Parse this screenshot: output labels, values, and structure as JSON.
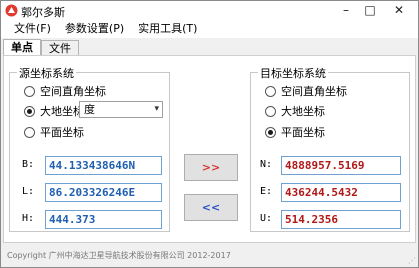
{
  "window": {
    "title": "郭尔多斯"
  },
  "menu": [
    "文件(F)",
    "参数设置(P)",
    "实用工具(T)"
  ],
  "tabs": [
    "单点",
    "文件"
  ],
  "source": {
    "group_title": "源坐标系统",
    "options": [
      "空间直角坐标",
      "大地坐标",
      "平面坐标"
    ],
    "selected": 1,
    "unit_select": "度",
    "fields": [
      {
        "label": "B:",
        "value": "44.133438646N"
      },
      {
        "label": "L:",
        "value": "86.203326246E"
      },
      {
        "label": "H:",
        "value": "444.373"
      }
    ]
  },
  "target": {
    "group_title": "目标坐标系统",
    "options": [
      "空间直角坐标",
      "大地坐标",
      "平面坐标"
    ],
    "selected": 2,
    "fields": [
      {
        "label": "N:",
        "value": "4888957.5169"
      },
      {
        "label": "E:",
        "value": "436244.5432"
      },
      {
        "label": "U:",
        "value": "514.2356"
      }
    ]
  },
  "buttons": {
    "forward": ">>",
    "backward": "<<"
  },
  "status": {
    "copyright": "Copyright 广州中海达卫星导航技术股份有限公司 2012-2017"
  },
  "icons": {
    "close": "close-icon",
    "minimize": "minimize-icon",
    "maximize": "maximize-icon"
  }
}
